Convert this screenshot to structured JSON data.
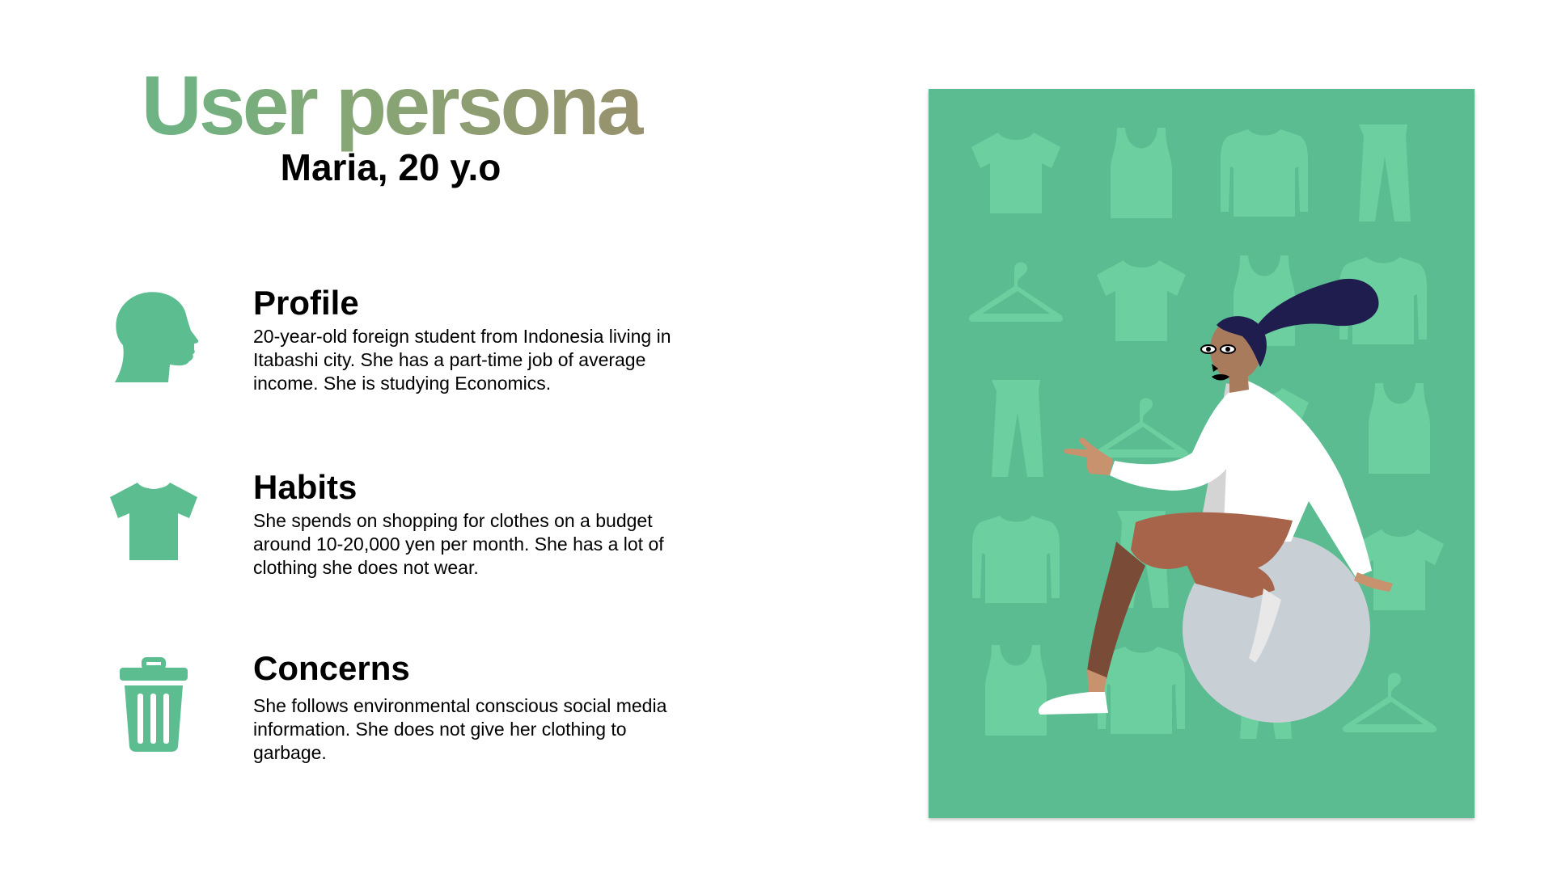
{
  "header": {
    "title": "User persona",
    "subtitle": "Maria, 20 y.o"
  },
  "sections": [
    {
      "heading": "Profile",
      "text": "20-year-old foreign student from Indonesia living in\nItabashi city. She has a part-time job of average\nincome. She is studying Economics.",
      "icon": "head-profile-icon"
    },
    {
      "heading": "Habits",
      "text": "She spends on shopping for clothes on a budget\naround 10-20,000 yen per month. She has a lot  of\nclothing she does not wear.",
      "icon": "tshirt-icon"
    },
    {
      "heading": "Concerns",
      "text": "She follows environmental conscious social media\ninformation. She does not give her clothing to\ngarbage.",
      "icon": "trash-can-icon"
    }
  ],
  "colors": {
    "accent": "#5bbd90",
    "title_gradient_start": "#5bbd90",
    "title_gradient_end": "#a0876b",
    "illustration_bg": "#5bbc91",
    "illustration_pattern": "#6ccf9f"
  }
}
